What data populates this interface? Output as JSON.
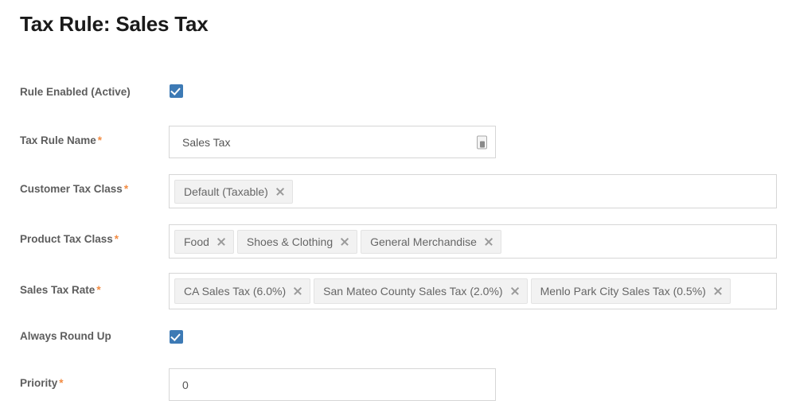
{
  "page": {
    "title": "Tax Rule: Sales Tax",
    "required_marker": "*"
  },
  "theme": {
    "checkbox_checked_color": "#3d7ab5",
    "required_asterisk_color": "#f28b42",
    "label_color": "#5d5d5d",
    "chip_background": "#f2f2f2",
    "chip_text_color": "#666666",
    "input_border_color": "#d6d6d6",
    "title_color": "#1a1a1a"
  },
  "form": {
    "rule_enabled": {
      "label": "Rule Enabled (Active)",
      "checked": true
    },
    "tax_rule_name": {
      "label": "Tax Rule Name",
      "value": "Sales Tax",
      "placeholder": "",
      "required": true
    },
    "customer_tax_class": {
      "label": "Customer Tax Class",
      "required": true,
      "chips": [
        {
          "label": "Default (Taxable)"
        }
      ]
    },
    "product_tax_class": {
      "label": "Product Tax Class",
      "required": true,
      "chips": [
        {
          "label": "Food"
        },
        {
          "label": "Shoes & Clothing"
        },
        {
          "label": "General Merchandise"
        }
      ]
    },
    "sales_tax_rate": {
      "label": "Sales Tax Rate",
      "required": true,
      "chips": [
        {
          "label": "CA Sales Tax (6.0%)"
        },
        {
          "label": "San Mateo County Sales Tax (2.0%)"
        },
        {
          "label": "Menlo Park City Sales Tax (0.5%)"
        }
      ]
    },
    "always_round_up": {
      "label": "Always Round Up",
      "checked": true
    },
    "priority": {
      "label": "Priority",
      "value": "0",
      "placeholder": "",
      "required": true
    }
  }
}
